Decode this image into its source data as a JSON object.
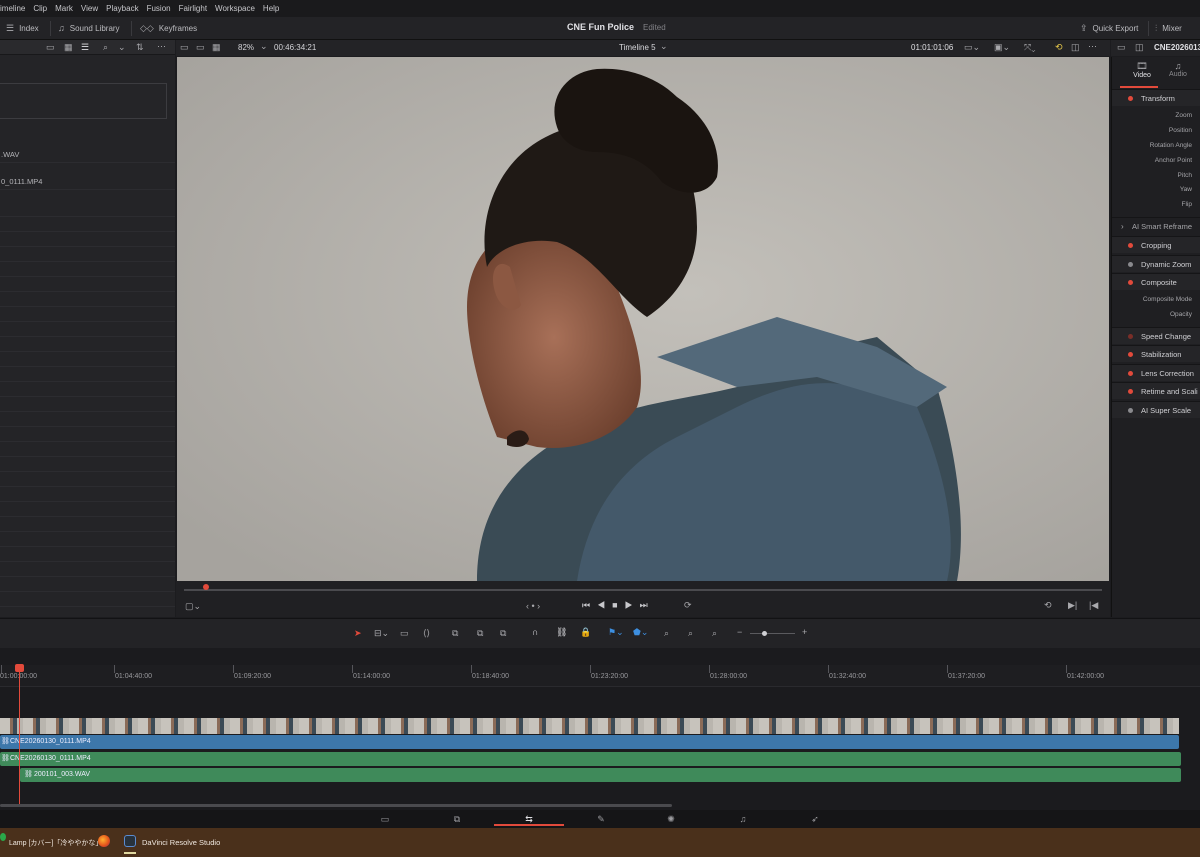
{
  "menu": [
    "imeline",
    "Clip",
    "Mark",
    "View",
    "Playback",
    "Fusion",
    "Fairlight",
    "Workspace",
    "Help"
  ],
  "toolbar": {
    "index": "Index",
    "sound_library": "Sound Library",
    "keyframes": "Keyframes",
    "project": "CNE Fun Police",
    "status": "Edited",
    "quick_export": "Quick Export",
    "mixer": "Mixer"
  },
  "viewer": {
    "zoom": "82%",
    "source_tc": "00:46:34:21",
    "timeline_name": "Timeline 5",
    "record_tc": "01:01:01:06",
    "clip_name": "CNE2026013"
  },
  "media": {
    "items": [
      ".WAV",
      "0_0111.MP4"
    ]
  },
  "inspector": {
    "tabs": [
      {
        "label": "Video"
      },
      {
        "label": "Audio"
      }
    ],
    "transform": "Transform",
    "props": [
      "Zoom",
      "Position",
      "Rotation Angle",
      "Anchor Point",
      "Pitch",
      "Yaw",
      "Flip"
    ],
    "ai_reframe": "AI Smart Reframe",
    "cropping": "Cropping",
    "dynamic_zoom": "Dynamic Zoom",
    "composite": "Composite",
    "composite_props": [
      "Composite Mode",
      "Opacity"
    ],
    "speed_change": "Speed Change",
    "stabilization": "Stabilization",
    "lens_correction": "Lens Correction",
    "retime": "Retime and Scali",
    "ai_super_scale": "AI Super Scale"
  },
  "ruler": [
    "01:00:00:00",
    "01:04:40:00",
    "01:09:20:00",
    "01:14:00:00",
    "01:18:40:00",
    "01:23:20:00",
    "01:28:00:00",
    "01:32:40:00",
    "01:37:20:00",
    "01:42:00:00"
  ],
  "tracks": {
    "v1": "CNE20260130_0111.MP4",
    "a1": "CNE20260130_0111.MP4",
    "a2": "200101_003.WAV"
  },
  "taskbar": {
    "music": "Lamp [カバー]「冷ややかな」",
    "app": "DaVinci Resolve Studio"
  },
  "colors": {
    "accent": "#e24a3b",
    "video_clip": "#3d77aa",
    "audio_clip": "#3f8a5a"
  }
}
